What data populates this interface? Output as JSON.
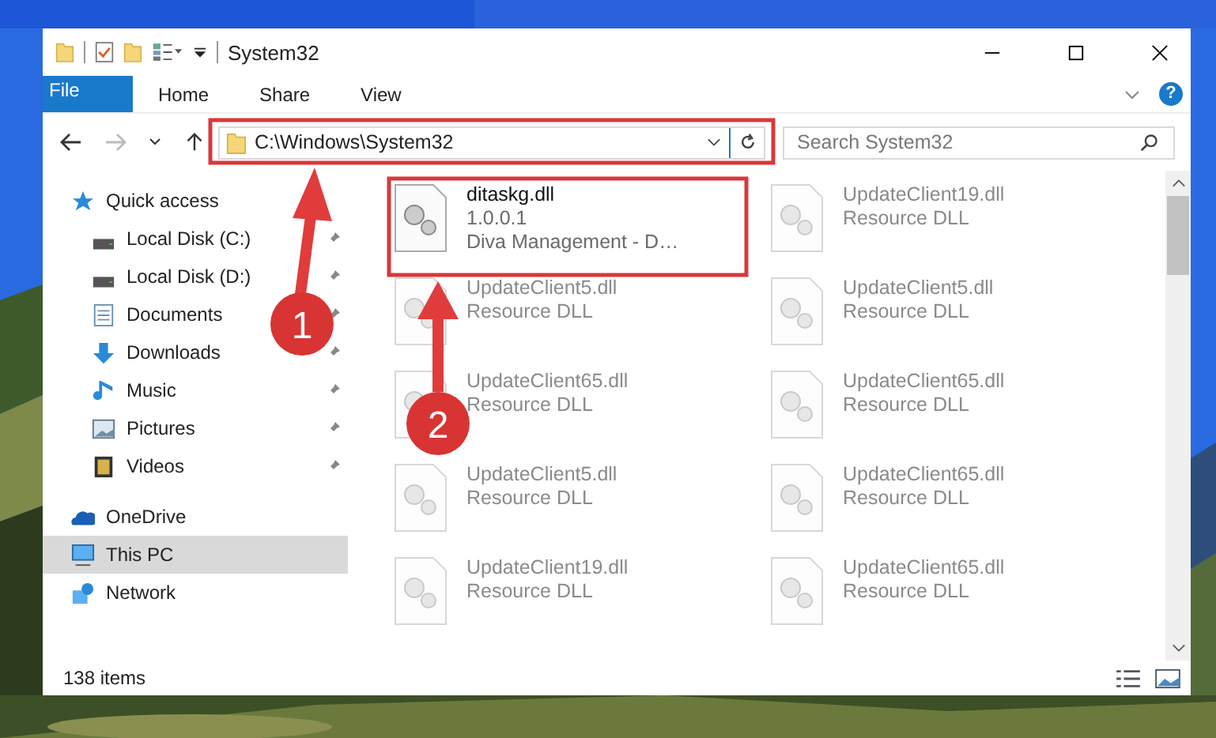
{
  "window": {
    "title": "System32"
  },
  "ribbon": {
    "tabs": [
      {
        "label": "File",
        "kind": "file",
        "selected": false
      },
      {
        "label": "Home",
        "kind": "tab",
        "selected": false
      },
      {
        "label": "Share",
        "kind": "tab",
        "selected": false
      },
      {
        "label": "View",
        "kind": "tab",
        "selected": false
      }
    ],
    "help": "?"
  },
  "address_bar": {
    "path": "C:\\Windows\\System32"
  },
  "search": {
    "placeholder": "Search System32"
  },
  "sidebar": {
    "items": [
      {
        "label": "Quick access",
        "kind": "star",
        "selected": false,
        "children": [
          {
            "label": "Local Disk (C:)",
            "kind": "drive",
            "pinned": true
          },
          {
            "label": "Local Disk (D:)",
            "kind": "drive",
            "pinned": true
          },
          {
            "label": "Documents",
            "kind": "documents",
            "pinned": true
          },
          {
            "label": "Downloads",
            "kind": "download",
            "pinned": true
          },
          {
            "label": "Music",
            "kind": "music",
            "pinned": true
          },
          {
            "label": "Pictures",
            "kind": "pictures",
            "pinned": true
          },
          {
            "label": "Videos",
            "kind": "videos",
            "pinned": true
          }
        ]
      },
      {
        "label": "OneDrive",
        "kind": "cloud",
        "selected": false
      },
      {
        "label": "This PC",
        "kind": "pc",
        "selected": true
      },
      {
        "label": "Network",
        "kind": "network",
        "selected": false
      }
    ]
  },
  "files": [
    {
      "name": "ditaskg.dll",
      "details": [
        "1.0.0.1",
        "Diva Management - D…"
      ],
      "dimmed": false
    },
    {
      "name": "UpdateClient19.dll",
      "details": [
        "Resource DLL"
      ],
      "dimmed": true
    },
    {
      "name": "UpdateClient5.dll",
      "details": [
        "Resource DLL"
      ],
      "dimmed": true
    },
    {
      "name": "UpdateClient5.dll",
      "details": [
        "Resource DLL"
      ],
      "dimmed": true
    },
    {
      "name": "UpdateClient65.dll",
      "details": [
        "Resource DLL"
      ],
      "dimmed": true
    },
    {
      "name": "UpdateClient65.dll",
      "details": [
        "Resource DLL"
      ],
      "dimmed": true
    },
    {
      "name": "UpdateClient5.dll",
      "details": [
        "Resource DLL"
      ],
      "dimmed": true
    },
    {
      "name": "UpdateClient65.dll",
      "details": [
        "Resource DLL"
      ],
      "dimmed": true
    },
    {
      "name": "UpdateClient19.dll",
      "details": [
        "Resource DLL"
      ],
      "dimmed": true
    },
    {
      "name": "UpdateClient65.dll",
      "details": [
        "Resource DLL"
      ],
      "dimmed": true
    }
  ],
  "status_bar": {
    "item_count": "138 items"
  },
  "annotations": [
    {
      "label": "1"
    },
    {
      "label": "2"
    }
  ]
}
